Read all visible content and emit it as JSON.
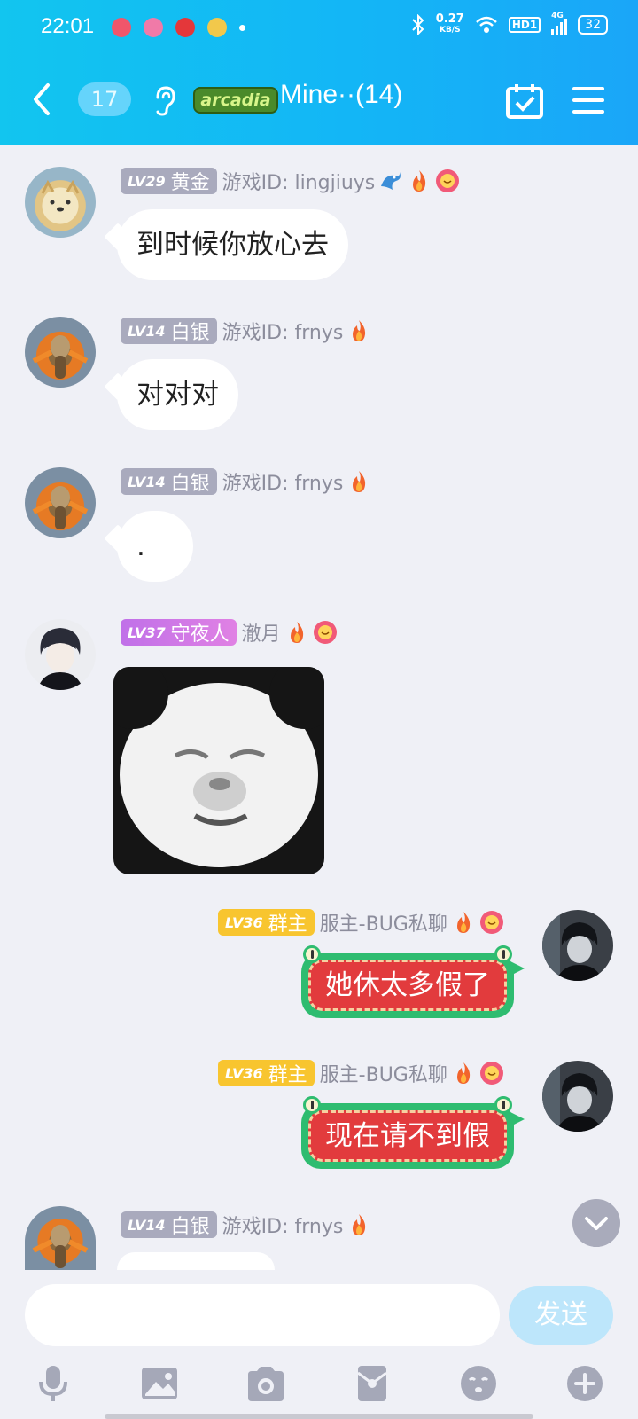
{
  "status_bar": {
    "time": "22:01",
    "net_speed_value": "0.27",
    "net_speed_unit": "KB/S",
    "hd_label": "HD1",
    "signal_label": "4G",
    "battery": "32"
  },
  "nav": {
    "unread_count": "17",
    "logo_text": "arcadia",
    "group_title": "Mine··(14)"
  },
  "messages": [
    {
      "level": "LV29",
      "rank": "黄金",
      "name": "游戏ID: lingjiuys",
      "text": "到时候你放心去"
    },
    {
      "level": "LV14",
      "rank": "白银",
      "name": "游戏ID: frnys",
      "text": "对对对"
    },
    {
      "level": "LV14",
      "rank": "白银",
      "name": "游戏ID: frnys",
      "text": "."
    },
    {
      "level": "LV37",
      "rank": "守夜人",
      "name": "澈月"
    },
    {
      "level": "LV36",
      "rank": "群主",
      "name": "服主-BUG私聊",
      "text": "她休太多假了"
    },
    {
      "level": "LV36",
      "rank": "群主",
      "name": "服主-BUG私聊",
      "text": "现在请不到假"
    },
    {
      "level": "LV14",
      "rank": "白银",
      "name": "游戏ID: frnys"
    }
  ],
  "composer": {
    "send_label": "发送"
  },
  "colors": {
    "header_start": "#12c5ef",
    "header_end": "#1aa6f8",
    "level_gray": "#a9aabd",
    "level_gold": "#f8c52f",
    "frog_green": "#2ebc70",
    "frog_red": "#e23b3d"
  },
  "icons": [
    "back-arrow-icon",
    "ear-icon",
    "calendar-check-icon",
    "menu-icon",
    "fire-icon",
    "flower-face-icon",
    "dragon-icon",
    "chevron-down-icon",
    "microphone-icon",
    "image-icon",
    "camera-icon",
    "red-packet-icon",
    "emoji-icon",
    "plus-icon"
  ]
}
